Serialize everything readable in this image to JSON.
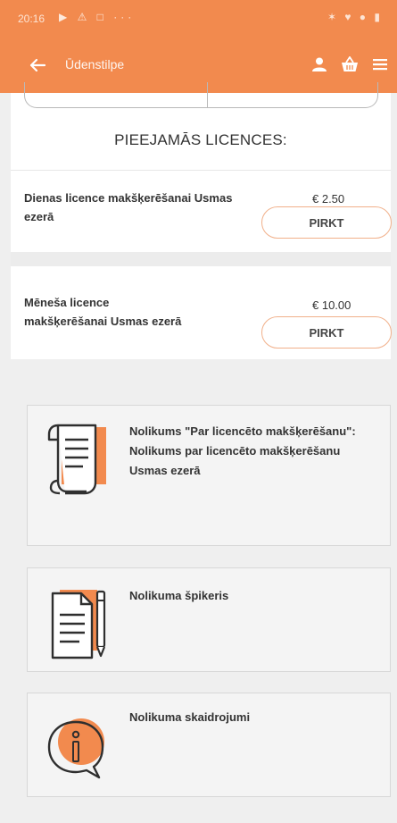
{
  "status": {
    "time": "20:16",
    "left_icons": "▶ ⚠ □ ···",
    "right_icons": "✶ ♥ ● ▮"
  },
  "appbar": {
    "title": "Ūdenstilpe",
    "icons": [
      "back-arrow-icon",
      "user-icon",
      "basket-icon",
      "menu-icon"
    ]
  },
  "licenses": {
    "section_title": "PIEEJAMĀS LICENCES:",
    "items": [
      {
        "name": "Dienas licence makšķerēšanai Usmas ezerā",
        "price": "€ 2.50",
        "button": "PIRKT"
      },
      {
        "name": "Mēneša licence makšķerēšanai Usmas ezerā",
        "price": "€ 10.00",
        "button": "PIRKT"
      }
    ]
  },
  "documents": [
    {
      "title": "Nolikums \"Par licencēto makšķerēšanu\": Nolikums par licencēto makšķerēšanu Usmas ezerā",
      "icon": "scroll-icon"
    },
    {
      "title": "Nolikuma špikeris",
      "icon": "document-pen-icon"
    },
    {
      "title": "Nolikuma skaidrojumi",
      "icon": "info-bubble-icon"
    }
  ],
  "colors": {
    "accent": "#f28a4e",
    "icon_shadow": "#f28a4e",
    "icon_stroke": "#2f2f2f",
    "background": "#efefef"
  }
}
